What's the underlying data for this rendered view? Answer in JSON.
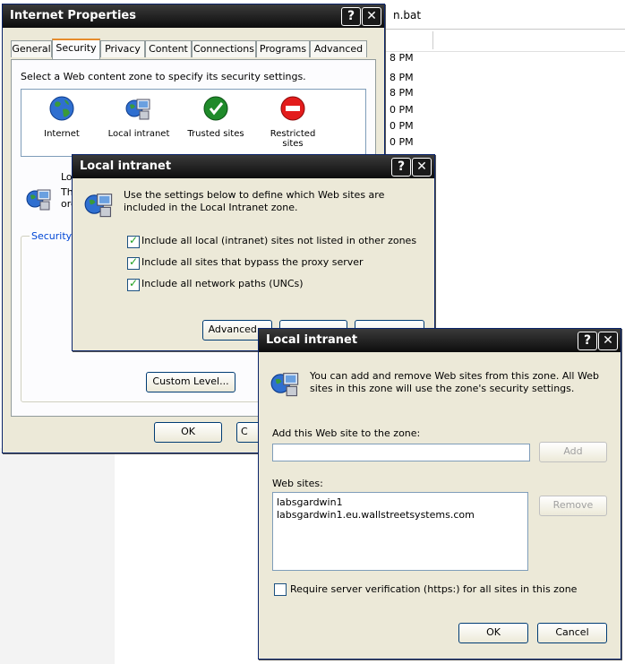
{
  "background": {
    "file_fragment": "n.bat",
    "times": [
      "8 PM",
      "8 PM",
      "8 PM",
      "0 PM",
      "0 PM",
      "0 PM"
    ]
  },
  "internet_properties": {
    "title": "Internet Properties",
    "help_label": "?",
    "close_label": "✕",
    "tabs": [
      {
        "label": "General"
      },
      {
        "label": "Security"
      },
      {
        "label": "Privacy"
      },
      {
        "label": "Content"
      },
      {
        "label": "Connections"
      },
      {
        "label": "Programs"
      },
      {
        "label": "Advanced"
      }
    ],
    "zone_prompt": "Select a Web content zone to specify its security settings.",
    "zones": [
      {
        "label": "Internet",
        "icon": "globe-icon"
      },
      {
        "label": "Local intranet",
        "icon": "network-computer-icon"
      },
      {
        "label": "Trusted sites",
        "icon": "check-icon"
      },
      {
        "label": "Restricted sites",
        "icon": "no-entry-icon"
      }
    ],
    "partial_zone_title": "Lo",
    "partial_desc_1": "Th",
    "partial_desc_2": "ord",
    "security_level_partial": "Security",
    "custom_level_label": "Custom Level...",
    "ok_label": "OK",
    "cancel_partial": "C"
  },
  "local_intranet_1": {
    "title": "Local intranet",
    "help_label": "?",
    "close_label": "✕",
    "description": "Use the settings below to define which Web sites are included in the Local Intranet zone.",
    "checkboxes": [
      {
        "label": "Include all local (intranet) sites not listed in other zones",
        "checked": true
      },
      {
        "label": "Include all sites that bypass the proxy server",
        "checked": true
      },
      {
        "label": "Include all network paths (UNCs)",
        "checked": true
      }
    ],
    "advanced_label": "Advanced..."
  },
  "local_intranet_2": {
    "title": "Local intranet",
    "help_label": "?",
    "close_label": "✕",
    "description": "You can add and remove Web sites from this zone. All Web sites in this zone will use the zone's security settings.",
    "add_label": "Add this Web site to the zone:",
    "add_input_value": "",
    "add_button": "Add",
    "websites_label": "Web sites:",
    "websites": [
      "labsgardwin1",
      "labsgardwin1.eu.wallstreetsystems.com"
    ],
    "remove_button": "Remove",
    "require_label": "Require server verification (https:) for all sites in this zone",
    "require_checked": false,
    "ok_label": "OK",
    "cancel_label": "Cancel"
  }
}
